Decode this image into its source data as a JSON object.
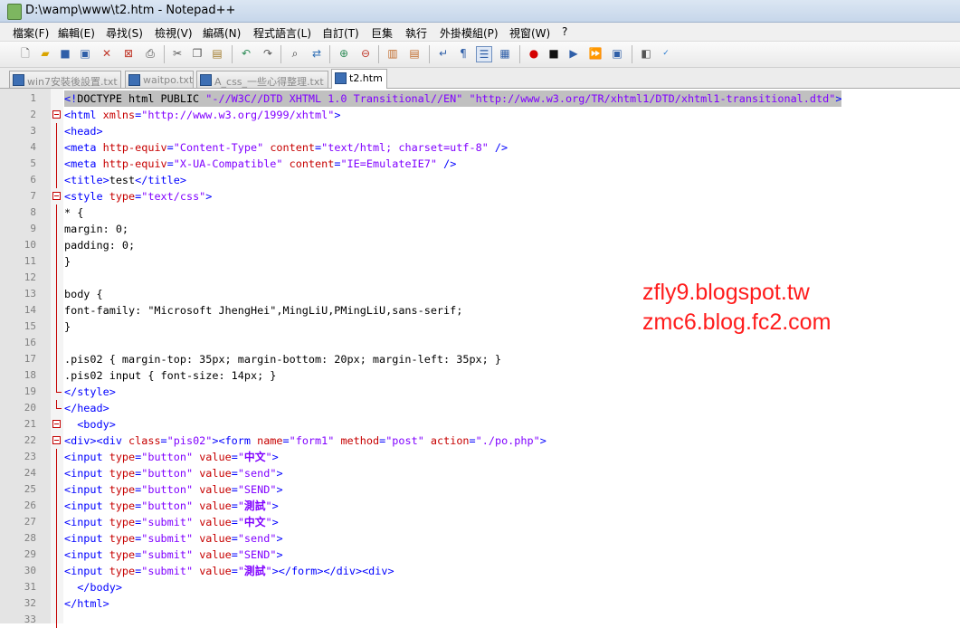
{
  "window": {
    "title": "D:\\wamp\\www\\t2.htm - Notepad++"
  },
  "menu": [
    "檔案(F)",
    "編輯(E)",
    "尋找(S)",
    "檢視(V)",
    "編碼(N)",
    "程式語言(L)",
    "自訂(T)",
    "巨集",
    "執行",
    "外掛模組(P)",
    "視窗(W)",
    "?"
  ],
  "toolbar": {
    "icons": [
      "new-file-icon",
      "open-file-icon",
      "save-icon",
      "save-all-icon",
      "close-icon",
      "close-all-icon",
      "print-icon",
      "cut-icon",
      "copy-icon",
      "paste-icon",
      "undo-icon",
      "redo-icon",
      "find-icon",
      "replace-icon",
      "zoom-in-icon",
      "zoom-out-icon",
      "sync-vertical-icon",
      "sync-horizontal-icon",
      "word-wrap-icon",
      "show-all-chars-icon",
      "indent-guide-icon",
      "user-lang-icon",
      "record-macro-icon",
      "stop-macro-icon",
      "play-macro-icon",
      "run-macro-multiple-icon",
      "save-macro-icon",
      "launch-browser-icon",
      "spell-check-icon"
    ]
  },
  "tabs": [
    {
      "label": "win7安裝後設置.txt",
      "active": false
    },
    {
      "label": "waitpo.txt",
      "active": false
    },
    {
      "label": "A_css_一些心得整理.txt",
      "active": false
    },
    {
      "label": "t2.htm",
      "active": true
    }
  ],
  "editor": {
    "lines": [
      [
        [
          "t",
          "<!"
        ],
        [
          "",
          "DOCTYPE html PUBLIC "
        ],
        [
          "s",
          "\"-//W3C//DTD XHTML 1.0 Transitional//EN\""
        ],
        [
          "",
          " "
        ],
        [
          "s",
          "\"http://www.w3.org/TR/xhtml1/DTD/xhtml1-transitional.dtd\""
        ],
        [
          "t",
          ">"
        ]
      ],
      [
        [
          "t",
          "<html "
        ],
        [
          "a",
          "xmlns"
        ],
        [
          "t",
          "="
        ],
        [
          "s",
          "\"http://www.w3.org/1999/xhtml\""
        ],
        [
          "t",
          ">"
        ]
      ],
      [
        [
          "t",
          "<head>"
        ]
      ],
      [
        [
          "t",
          "<meta "
        ],
        [
          "a",
          "http-equiv"
        ],
        [
          "t",
          "="
        ],
        [
          "s",
          "\"Content-Type\""
        ],
        [
          "",
          " "
        ],
        [
          "a",
          "content"
        ],
        [
          "t",
          "="
        ],
        [
          "s",
          "\"text/html; charset=utf-8\""
        ],
        [
          "t",
          " />"
        ]
      ],
      [
        [
          "t",
          "<meta "
        ],
        [
          "a",
          "http-equiv"
        ],
        [
          "t",
          "="
        ],
        [
          "s",
          "\"X-UA-Compatible\""
        ],
        [
          "",
          " "
        ],
        [
          "a",
          "content"
        ],
        [
          "t",
          "="
        ],
        [
          "s",
          "\"IE=EmulateIE7\""
        ],
        [
          "t",
          " />"
        ]
      ],
      [
        [
          "t",
          "<title>"
        ],
        [
          "",
          "test"
        ],
        [
          "t",
          "</title>"
        ]
      ],
      [
        [
          "t",
          "<style "
        ],
        [
          "a",
          "type"
        ],
        [
          "t",
          "="
        ],
        [
          "s",
          "\"text/css\""
        ],
        [
          "t",
          ">"
        ]
      ],
      [
        [
          "",
          "* {"
        ]
      ],
      [
        [
          "",
          "margin: 0;"
        ]
      ],
      [
        [
          "",
          "padding: 0;"
        ]
      ],
      [
        [
          "",
          "}"
        ]
      ],
      [
        [
          "",
          ""
        ]
      ],
      [
        [
          "",
          "body {"
        ]
      ],
      [
        [
          "",
          "font-family: \"Microsoft JhengHei\",MingLiU,PMingLiU,sans-serif;"
        ]
      ],
      [
        [
          "",
          "}"
        ]
      ],
      [
        [
          "",
          ""
        ]
      ],
      [
        [
          "",
          ".pis02 { margin-top: 35px; margin-bottom: 20px; margin-left: 35px; }"
        ]
      ],
      [
        [
          "",
          ".pis02 input { font-size: 14px; }"
        ]
      ],
      [
        [
          "t",
          "</style>"
        ]
      ],
      [
        [
          "t",
          "</head>"
        ]
      ],
      [
        [
          "t",
          "  <body>"
        ]
      ],
      [
        [
          "t",
          "<div><div "
        ],
        [
          "a",
          "class"
        ],
        [
          "t",
          "="
        ],
        [
          "s",
          "\"pis02\""
        ],
        [
          "t",
          "><form "
        ],
        [
          "a",
          "name"
        ],
        [
          "t",
          "="
        ],
        [
          "s",
          "\"form1\""
        ],
        [
          "",
          " "
        ],
        [
          "a",
          "method"
        ],
        [
          "t",
          "="
        ],
        [
          "s",
          "\"post\""
        ],
        [
          "",
          " "
        ],
        [
          "a",
          "action"
        ],
        [
          "t",
          "="
        ],
        [
          "s",
          "\"./po.php\""
        ],
        [
          "t",
          ">"
        ]
      ],
      [
        [
          "t",
          "<input "
        ],
        [
          "a",
          "type"
        ],
        [
          "t",
          "="
        ],
        [
          "s",
          "\"button\""
        ],
        [
          "",
          " "
        ],
        [
          "a",
          "value"
        ],
        [
          "t",
          "="
        ],
        [
          "s",
          "\""
        ],
        [
          "bs",
          "中文"
        ],
        [
          "s",
          "\""
        ],
        [
          "t",
          ">"
        ]
      ],
      [
        [
          "t",
          "<input "
        ],
        [
          "a",
          "type"
        ],
        [
          "t",
          "="
        ],
        [
          "s",
          "\"button\""
        ],
        [
          "",
          " "
        ],
        [
          "a",
          "value"
        ],
        [
          "t",
          "="
        ],
        [
          "s",
          "\"send\""
        ],
        [
          "t",
          ">"
        ]
      ],
      [
        [
          "t",
          "<input "
        ],
        [
          "a",
          "type"
        ],
        [
          "t",
          "="
        ],
        [
          "s",
          "\"button\""
        ],
        [
          "",
          " "
        ],
        [
          "a",
          "value"
        ],
        [
          "t",
          "="
        ],
        [
          "s",
          "\"SEND\""
        ],
        [
          "t",
          ">"
        ]
      ],
      [
        [
          "t",
          "<input "
        ],
        [
          "a",
          "type"
        ],
        [
          "t",
          "="
        ],
        [
          "s",
          "\"button\""
        ],
        [
          "",
          " "
        ],
        [
          "a",
          "value"
        ],
        [
          "t",
          "="
        ],
        [
          "s",
          "\""
        ],
        [
          "bs",
          "測試"
        ],
        [
          "s",
          "\""
        ],
        [
          "t",
          ">"
        ]
      ],
      [
        [
          "t",
          "<input "
        ],
        [
          "a",
          "type"
        ],
        [
          "t",
          "="
        ],
        [
          "s",
          "\"submit\""
        ],
        [
          "",
          " "
        ],
        [
          "a",
          "value"
        ],
        [
          "t",
          "="
        ],
        [
          "s",
          "\""
        ],
        [
          "bs",
          "中文"
        ],
        [
          "s",
          "\""
        ],
        [
          "t",
          ">"
        ]
      ],
      [
        [
          "t",
          "<input "
        ],
        [
          "a",
          "type"
        ],
        [
          "t",
          "="
        ],
        [
          "s",
          "\"submit\""
        ],
        [
          "",
          " "
        ],
        [
          "a",
          "value"
        ],
        [
          "t",
          "="
        ],
        [
          "s",
          "\"send\""
        ],
        [
          "t",
          ">"
        ]
      ],
      [
        [
          "t",
          "<input "
        ],
        [
          "a",
          "type"
        ],
        [
          "t",
          "="
        ],
        [
          "s",
          "\"submit\""
        ],
        [
          "",
          " "
        ],
        [
          "a",
          "value"
        ],
        [
          "t",
          "="
        ],
        [
          "s",
          "\"SEND\""
        ],
        [
          "t",
          ">"
        ]
      ],
      [
        [
          "t",
          "<input "
        ],
        [
          "a",
          "type"
        ],
        [
          "t",
          "="
        ],
        [
          "s",
          "\"submit\""
        ],
        [
          "",
          " "
        ],
        [
          "a",
          "value"
        ],
        [
          "t",
          "="
        ],
        [
          "s",
          "\""
        ],
        [
          "bs",
          "測試"
        ],
        [
          "s",
          "\""
        ],
        [
          "t",
          "></form></div><div>"
        ]
      ],
      [
        [
          "t",
          "  </body>"
        ]
      ],
      [
        [
          "t",
          "</html>"
        ]
      ],
      [
        [
          "",
          ""
        ]
      ]
    ],
    "folds": [
      "",
      "m",
      "v",
      "v",
      "v",
      "v",
      "m",
      "v",
      "v",
      "v",
      "v",
      "v",
      "v",
      "v",
      "v",
      "v",
      "v",
      "v",
      "e",
      "e",
      "m",
      "m",
      "v",
      "v",
      "v",
      "v",
      "v",
      "v",
      "v",
      "v",
      "v",
      "v",
      "v"
    ]
  },
  "watermark": [
    "zfly9.blogspot.tw",
    "zmc6.blog.fc2.com"
  ],
  "colors": {
    "tag": "#0000ff",
    "attribute": "#c60000",
    "string": "#8000ff",
    "fold_marker": "#c40000",
    "watermark": "#ff1c1c"
  }
}
